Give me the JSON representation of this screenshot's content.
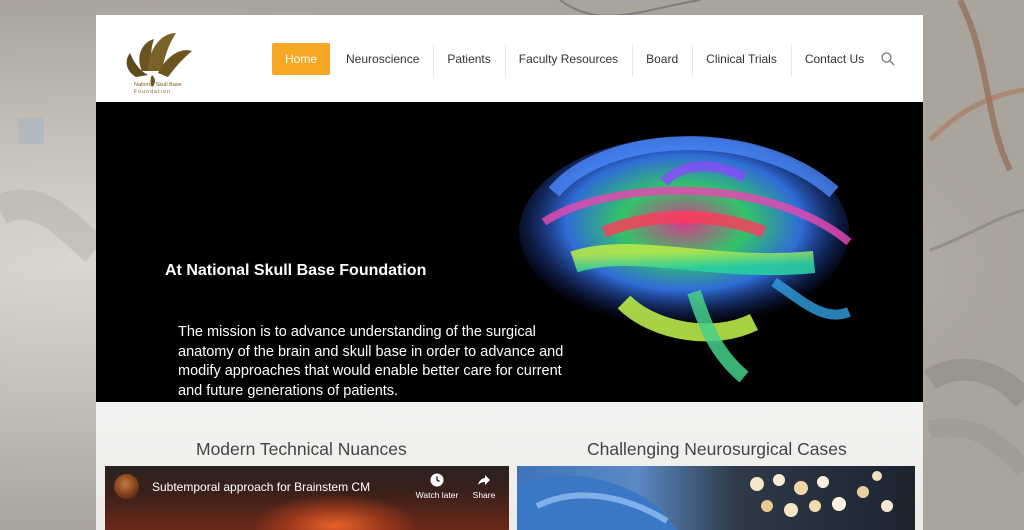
{
  "logo": {
    "line1": "National Skull Base",
    "line2": "Foundation",
    "color": "#6b5420"
  },
  "nav": {
    "items": [
      {
        "label": "Home",
        "active": true
      },
      {
        "label": "Neuroscience"
      },
      {
        "label": "Patients"
      },
      {
        "label": "Faculty Resources"
      },
      {
        "label": "Board"
      },
      {
        "label": "Clinical Trials"
      },
      {
        "label": "Contact Us"
      }
    ],
    "search_icon": "search-icon",
    "active_color": "#f5a623"
  },
  "hero": {
    "title": "At National Skull Base Foundation",
    "text": "The mission is to advance understanding of the surgical anatomy of the brain and skull base in order to advance and modify approaches that would enable better care for current and future generations of patients."
  },
  "sections": {
    "left_title": "Modern Technical Nuances",
    "right_title": "Challenging Neurosurgical Cases"
  },
  "video": {
    "title": "Subtemporal approach for Brainstem CM",
    "watch_later": "Watch later",
    "share": "Share"
  }
}
